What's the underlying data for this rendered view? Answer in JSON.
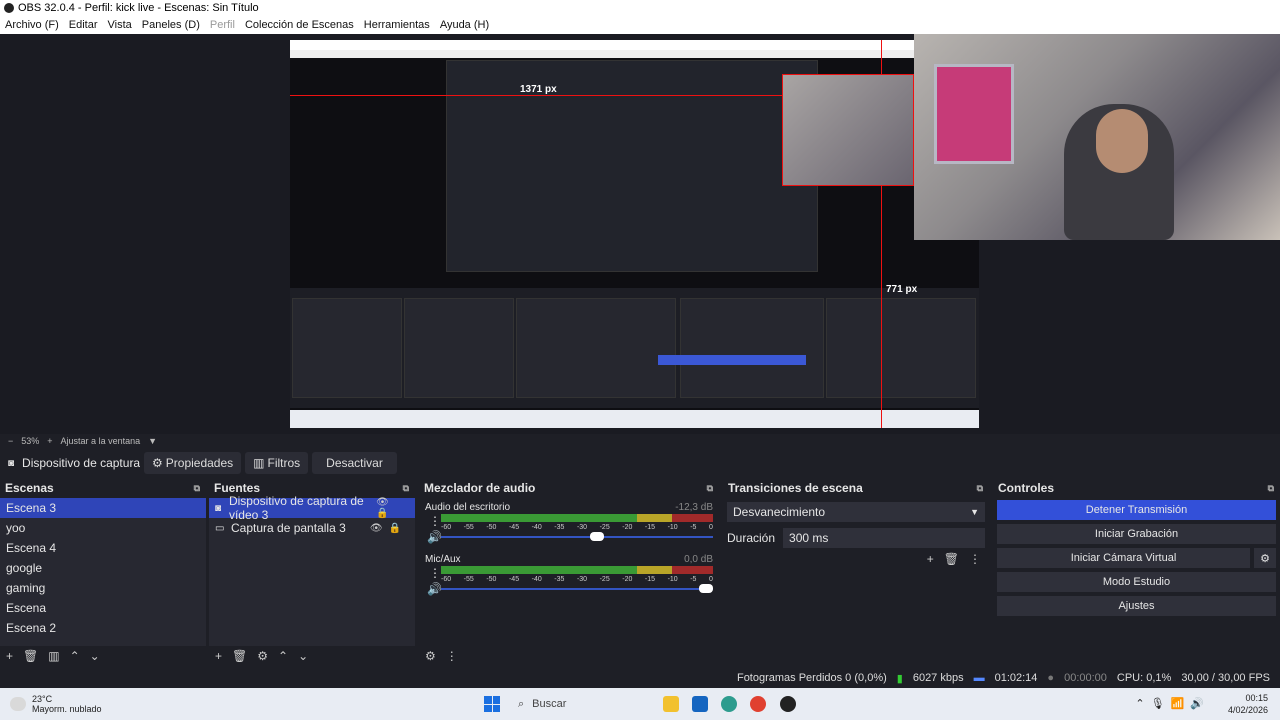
{
  "window": {
    "title": "OBS 32.0.4 - Perfil: kick live - Escenas: Sin Título"
  },
  "menu": [
    "Archivo (F)",
    "Editar",
    "Vista",
    "Paneles (D)",
    "Perfil",
    "Colección de Escenas",
    "Herramientas",
    "Ayuda (H)"
  ],
  "preview": {
    "measure_width": "1371 px",
    "measure_height": "771 px"
  },
  "zoom": {
    "value": "53%",
    "fit": "Ajustar a la ventana"
  },
  "toolbar": {
    "source_name": "Dispositivo de captura de v",
    "properties": "Propiedades",
    "filters": "Filtros",
    "deactivate": "Desactivar"
  },
  "scenes": {
    "title": "Escenas",
    "items": [
      "Escena 3",
      "yoo",
      "Escena 4",
      "google",
      "gaming",
      "Escena",
      "Escena 2"
    ]
  },
  "sources": {
    "title": "Fuentes",
    "items": [
      "Dispositivo de captura de vídeo 3",
      "Captura de pantalla 3"
    ]
  },
  "mixer": {
    "title": "Mezclador de audio",
    "channels": [
      {
        "name": "Audio del escritorio",
        "db": "-12,3 dB",
        "volume": 0.6
      },
      {
        "name": "Mic/Aux",
        "db": "0,0 dB",
        "volume": 1.0
      }
    ],
    "ticks": [
      "-60",
      "-55",
      "-50",
      "-45",
      "-40",
      "-35",
      "-30",
      "-25",
      "-20",
      "-15",
      "-10",
      "-5",
      "0"
    ]
  },
  "transitions": {
    "title": "Transiciones de escena",
    "selected": "Desvanecimiento",
    "duration_label": "Duración",
    "duration_value": "300 ms"
  },
  "controls": {
    "title": "Controles",
    "stop_stream": "Detener Transmisión",
    "start_recording": "Iniciar Grabación",
    "virtual_cam": "Iniciar Cámara Virtual",
    "studio_mode": "Modo Estudio",
    "settings": "Ajustes"
  },
  "status": {
    "dropped": "Fotogramas Perdidos 0 (0,0%)",
    "kbps": "6027 kbps",
    "live_time": "01:02:14",
    "rec_time": "00:00:00",
    "cpu": "CPU: 0,1%",
    "fps": "30,00 / 30,00 FPS"
  },
  "taskbar": {
    "temp": "23°C",
    "weather": "Mayorm. nublado",
    "search": "Buscar",
    "time": "00:15",
    "date": "4/02/2026"
  },
  "colors": {
    "accent": "#3350d9",
    "selected": "#2f45b8",
    "guide": "#ee1111"
  }
}
